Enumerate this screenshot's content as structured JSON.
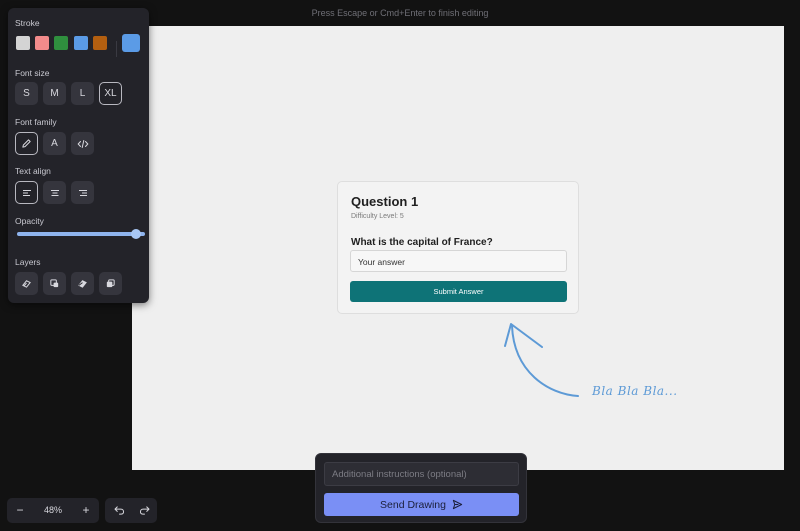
{
  "hint": "Press Escape or Cmd+Enter to finish editing",
  "toolbar": {
    "stroke_label": "Stroke",
    "stroke_colors": [
      "#d4d4d4",
      "#f28b8b",
      "#2f8f3e",
      "#5b9be6",
      "#b35f10"
    ],
    "stroke_selected": "#5b9be6",
    "font_size_label": "Font size",
    "font_sizes": [
      "S",
      "M",
      "L",
      "XL"
    ],
    "font_family_label": "Font family",
    "font_family_icons": [
      "pencil-icon",
      "letter-a-icon",
      "code-icon"
    ],
    "font_family_a": "A",
    "text_align_label": "Text align",
    "text_align_icons": [
      "align-left-icon",
      "align-center-icon",
      "align-right-icon"
    ],
    "opacity_label": "Opacity",
    "opacity_value": 1.0,
    "layers_label": "Layers",
    "layers_icons": [
      "send-to-back-icon",
      "send-backward-icon",
      "bring-forward-icon",
      "bring-to-front-icon"
    ]
  },
  "card": {
    "title": "Question 1",
    "difficulty": "Difficulty Level: 5",
    "question": "What is the capital of France?",
    "answer_placeholder": "Your answer",
    "submit_label": "Submit Answer"
  },
  "annotation": {
    "text": "Bla Bla Bla...",
    "color": "#5d9ad6"
  },
  "zoom": {
    "minus": "−",
    "value": "48%",
    "plus": "+"
  },
  "send": {
    "instructions_placeholder": "Additional instructions (optional)",
    "button_label": "Send Drawing"
  },
  "colors": {
    "accent": "#7a8ff5",
    "submit": "#0e7377"
  }
}
